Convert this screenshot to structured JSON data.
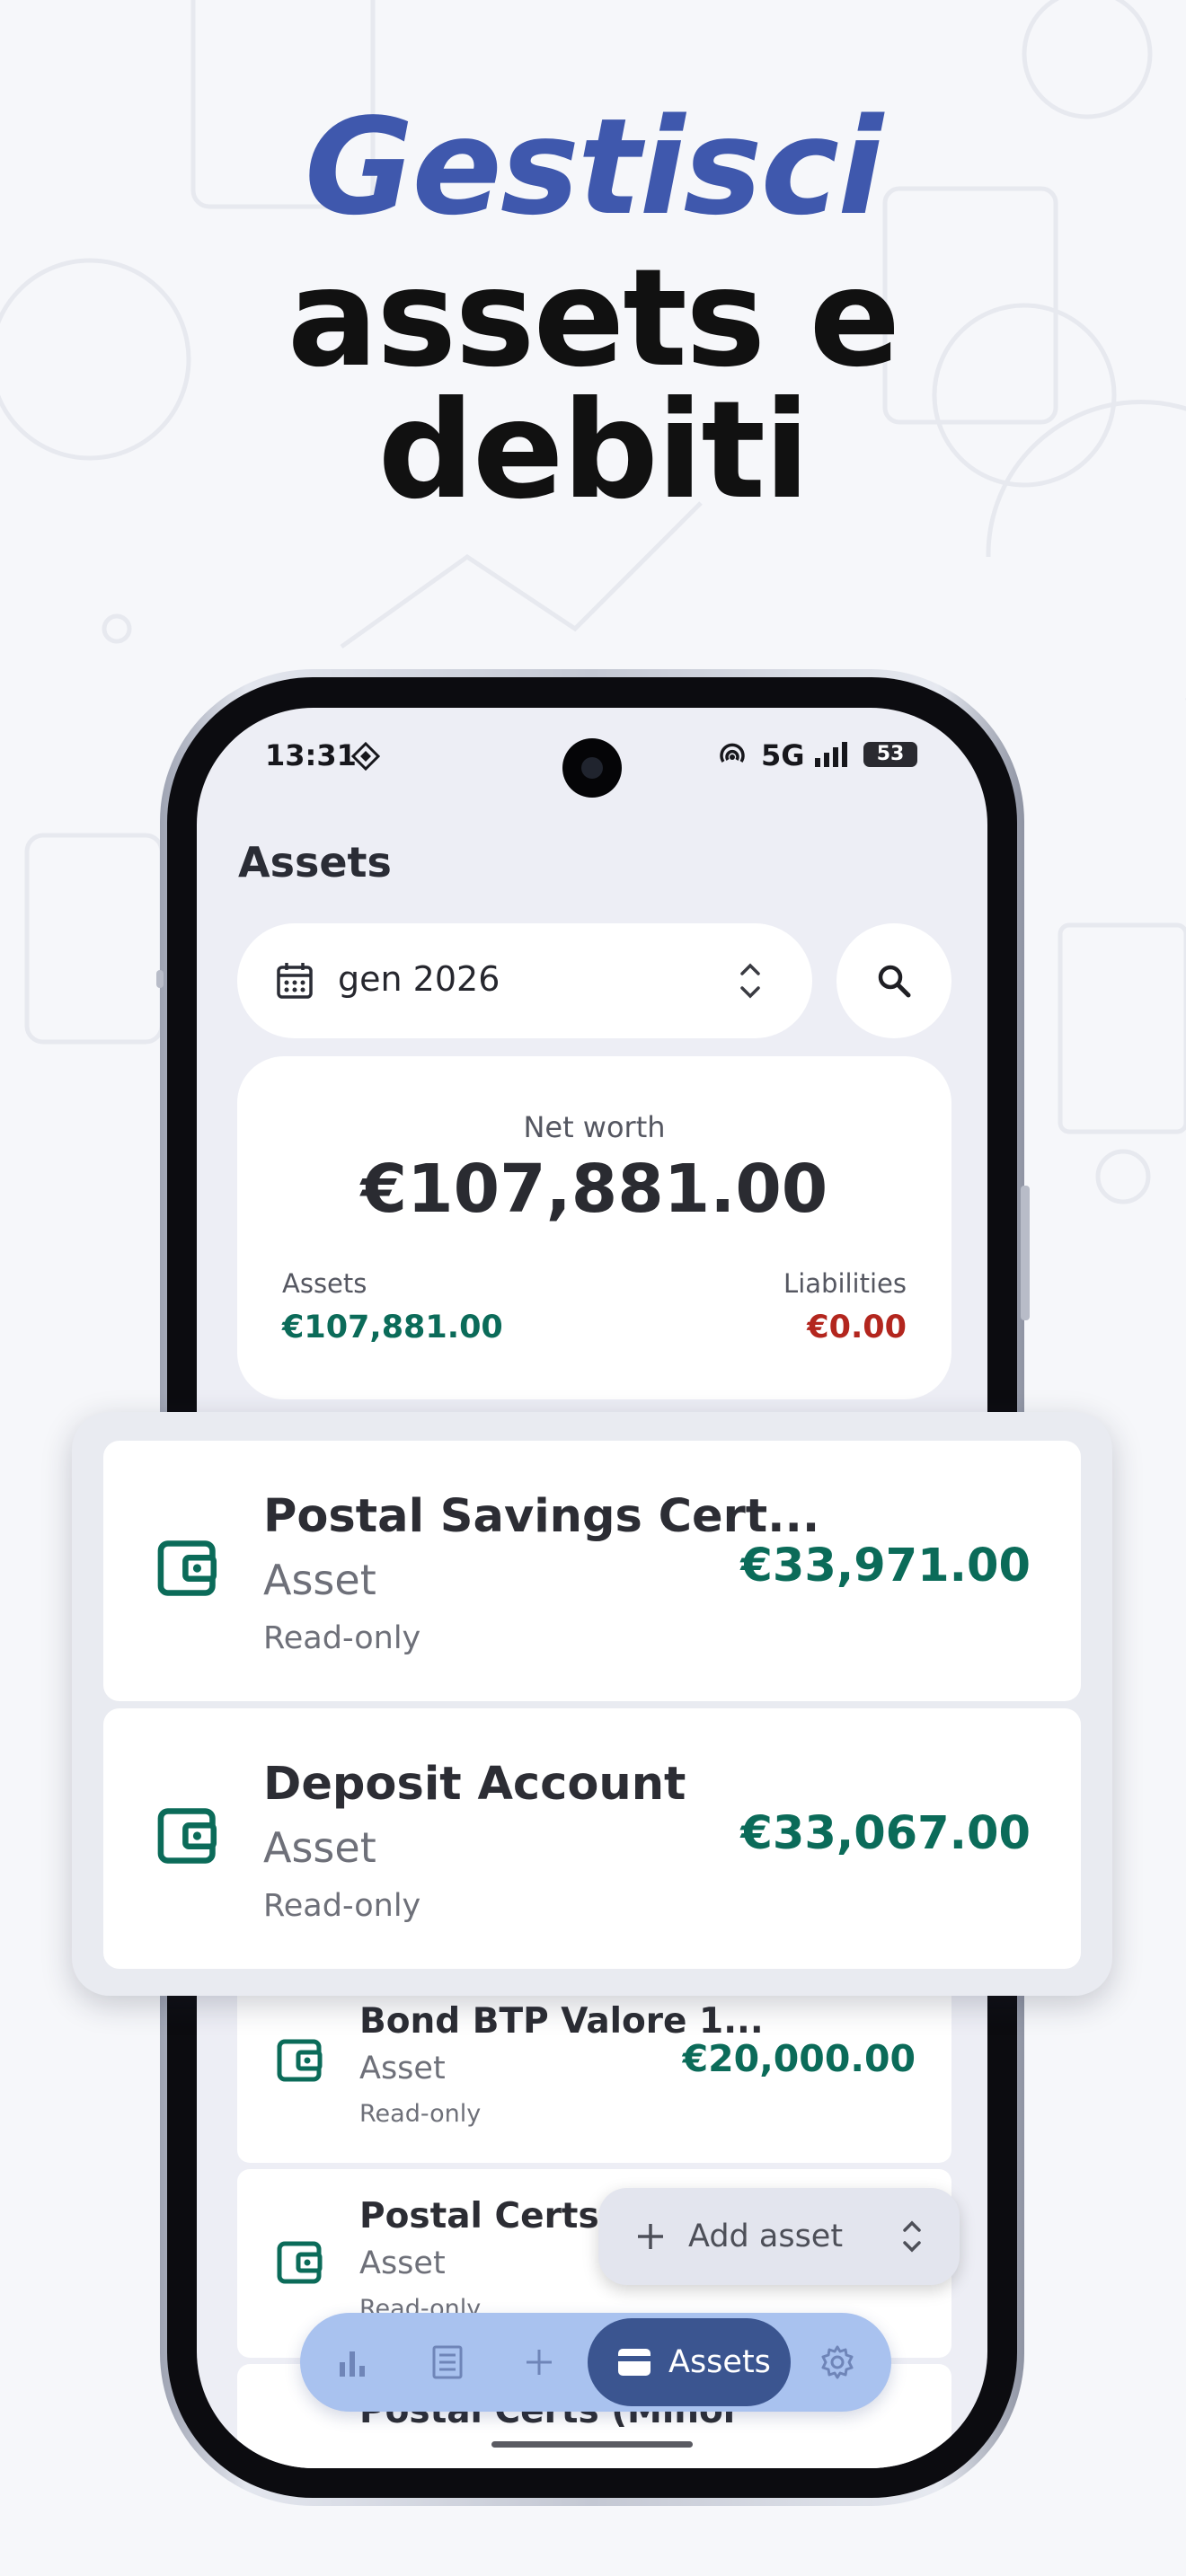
{
  "headline": {
    "line1": "Gestisci",
    "line2": "assets e",
    "line3": "debiti"
  },
  "colors": {
    "brand": "#3f58ad",
    "asset_green": "#0b6b59",
    "liability_red": "#b3261e",
    "nav_bar": "#a9c2ef",
    "nav_active": "#3b5590"
  },
  "status_bar": {
    "time": "13:31",
    "network": "5G",
    "battery": "53"
  },
  "header": {
    "title": "Assets"
  },
  "month_selector": {
    "value": "gen 2026",
    "icon": "calendar-icon"
  },
  "summary": {
    "net_worth_label": "Net worth",
    "net_worth_value": "€107,881.00",
    "assets_label": "Assets",
    "assets_value": "€107,881.00",
    "liabilities_label": "Liabilities",
    "liabilities_value": "€0.00"
  },
  "highlighted_items": [
    {
      "name": "Postal Savings Cert...",
      "kind": "Asset",
      "access": "Read-only",
      "amount": "€33,971.00"
    },
    {
      "name": "Deposit Account",
      "kind": "Asset",
      "access": "Read-only",
      "amount": "€33,067.00"
    }
  ],
  "list_items": [
    {
      "name": "Bond BTP Valore 1...",
      "kind": "Asset",
      "access": "Read-only",
      "amount": "€20,000.00"
    },
    {
      "name": "Postal Certs (M",
      "kind": "Asset",
      "access": "Read-only"
    },
    {
      "name": "Postal Certs (Minor"
    }
  ],
  "fab": {
    "label": "Add asset"
  },
  "bottom_nav": {
    "active_label": "Assets",
    "items": [
      "chart-icon",
      "ledger-icon",
      "plus-icon",
      "wallet-icon",
      "gear-icon"
    ]
  }
}
